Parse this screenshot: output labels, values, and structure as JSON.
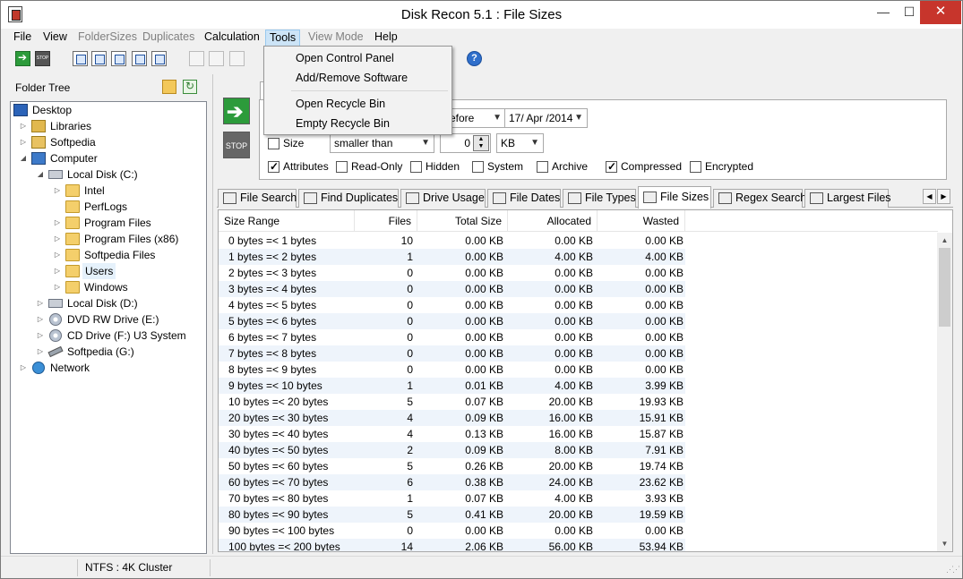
{
  "window": {
    "title": "Disk Recon 5.1 : File Sizes",
    "controls": {
      "minimize": "—",
      "maximize": "☐",
      "close": "✕"
    }
  },
  "menubar": {
    "items": [
      {
        "label": "File",
        "state": "normal"
      },
      {
        "label": "View",
        "state": "normal"
      },
      {
        "label": "FolderSizes",
        "state": "disabled"
      },
      {
        "label": "Duplicates",
        "state": "disabled"
      },
      {
        "label": "Calculation",
        "state": "normal"
      },
      {
        "label": "Tools",
        "state": "open"
      },
      {
        "label": "View Mode",
        "state": "disabled"
      },
      {
        "label": "Help",
        "state": "normal"
      }
    ]
  },
  "tools_menu": {
    "items": [
      "Open Control Panel",
      "Add/Remove Software",
      "Open Recycle Bin",
      "Empty Recycle Bin"
    ]
  },
  "toolbar": {
    "icons": [
      "start-scan-icon",
      "stop-scan-icon",
      "export-excel-icon",
      "export-html-icon",
      "export-csv-icon",
      "export-txt-icon",
      "export-xml-icon",
      "move-icon",
      "rename-icon",
      "delete-icon",
      "help-icon"
    ],
    "help_glyph": "?",
    "go_glyph": "➔",
    "stop_text": "STOP"
  },
  "folder_tree": {
    "label": "Folder Tree",
    "nodes": [
      {
        "label": "Desktop",
        "icon": "desktop",
        "arrow": ""
      },
      {
        "label": "Libraries",
        "icon": "libs",
        "arrow": "▷"
      },
      {
        "label": "Softpedia",
        "icon": "soft",
        "arrow": "▷"
      },
      {
        "label": "Computer",
        "icon": "computer",
        "arrow": "◢"
      },
      {
        "label": "Local Disk (C:)",
        "icon": "drive",
        "arrow": "◢"
      },
      {
        "label": "Intel",
        "icon": "folder",
        "arrow": "▷"
      },
      {
        "label": "PerfLogs",
        "icon": "folder",
        "arrow": ""
      },
      {
        "label": "Program Files",
        "icon": "folder",
        "arrow": "▷"
      },
      {
        "label": "Program Files (x86)",
        "icon": "folder",
        "arrow": "▷"
      },
      {
        "label": "Softpedia Files",
        "icon": "folder",
        "arrow": "▷"
      },
      {
        "label": "Users",
        "icon": "folder",
        "arrow": "▷"
      },
      {
        "label": "Windows",
        "icon": "folder",
        "arrow": "▷"
      },
      {
        "label": "Local Disk (D:)",
        "icon": "drive",
        "arrow": "▷"
      },
      {
        "label": "DVD RW Drive (E:)",
        "icon": "disc",
        "arrow": "▷"
      },
      {
        "label": "CD Drive (F:) U3 System",
        "icon": "disc",
        "arrow": "▷"
      },
      {
        "label": "Softpedia (G:)",
        "icon": "pen",
        "arrow": "▷"
      },
      {
        "label": "Network",
        "icon": "net",
        "arrow": "▷"
      }
    ]
  },
  "filters": {
    "date_mode": "efore",
    "date_value": "17/ Apr /2014",
    "size_label": "Size",
    "size_checked": false,
    "size_op": "smaller than",
    "size_value": "0",
    "size_unit": "KB",
    "attributes": [
      {
        "label": "Attributes",
        "checked": true
      },
      {
        "label": "Read-Only",
        "checked": false
      },
      {
        "label": "Hidden",
        "checked": false
      },
      {
        "label": "System",
        "checked": false
      },
      {
        "label": "Archive",
        "checked": false
      },
      {
        "label": "Compressed",
        "checked": true
      },
      {
        "label": "Encrypted",
        "checked": false
      }
    ]
  },
  "tabs": {
    "items": [
      "File Search",
      "Find Duplicates",
      "Drive Usage",
      "File Dates",
      "File Types",
      "File Sizes",
      "Regex Search",
      "Largest Files"
    ],
    "active": "File Sizes",
    "scroll_left": "◀",
    "scroll_right": "▶"
  },
  "table": {
    "columns": [
      "Size Range",
      "Files",
      "Total Size",
      "Allocated",
      "Wasted"
    ],
    "rows": [
      [
        "0 bytes =< 1 bytes",
        "10",
        "0.00 KB",
        "0.00 KB",
        "0.00 KB"
      ],
      [
        "1 bytes =< 2 bytes",
        "1",
        "0.00 KB",
        "4.00 KB",
        "4.00 KB"
      ],
      [
        "2 bytes =< 3 bytes",
        "0",
        "0.00 KB",
        "0.00 KB",
        "0.00 KB"
      ],
      [
        "3 bytes =< 4 bytes",
        "0",
        "0.00 KB",
        "0.00 KB",
        "0.00 KB"
      ],
      [
        "4 bytes =< 5 bytes",
        "0",
        "0.00 KB",
        "0.00 KB",
        "0.00 KB"
      ],
      [
        "5 bytes =< 6 bytes",
        "0",
        "0.00 KB",
        "0.00 KB",
        "0.00 KB"
      ],
      [
        "6 bytes =< 7 bytes",
        "0",
        "0.00 KB",
        "0.00 KB",
        "0.00 KB"
      ],
      [
        "7 bytes =< 8 bytes",
        "0",
        "0.00 KB",
        "0.00 KB",
        "0.00 KB"
      ],
      [
        "8 bytes =< 9 bytes",
        "0",
        "0.00 KB",
        "0.00 KB",
        "0.00 KB"
      ],
      [
        "9 bytes =< 10 bytes",
        "1",
        "0.01 KB",
        "4.00 KB",
        "3.99 KB"
      ],
      [
        "10 bytes =< 20 bytes",
        "5",
        "0.07 KB",
        "20.00 KB",
        "19.93 KB"
      ],
      [
        "20 bytes =< 30 bytes",
        "4",
        "0.09 KB",
        "16.00 KB",
        "15.91 KB"
      ],
      [
        "30 bytes =< 40 bytes",
        "4",
        "0.13 KB",
        "16.00 KB",
        "15.87 KB"
      ],
      [
        "40 bytes =< 50 bytes",
        "2",
        "0.09 KB",
        "8.00 KB",
        "7.91 KB"
      ],
      [
        "50 bytes =< 60 bytes",
        "5",
        "0.26 KB",
        "20.00 KB",
        "19.74 KB"
      ],
      [
        "60 bytes =< 70 bytes",
        "6",
        "0.38 KB",
        "24.00 KB",
        "23.62 KB"
      ],
      [
        "70 bytes =< 80 bytes",
        "1",
        "0.07 KB",
        "4.00 KB",
        "3.93 KB"
      ],
      [
        "80 bytes =< 90 bytes",
        "5",
        "0.41 KB",
        "20.00 KB",
        "19.59 KB"
      ],
      [
        "90 bytes =< 100 bytes",
        "0",
        "0.00 KB",
        "0.00 KB",
        "0.00 KB"
      ],
      [
        "100 bytes =< 200 bytes",
        "14",
        "2.06 KB",
        "56.00 KB",
        "53.94 KB"
      ]
    ]
  },
  "statusbar": {
    "fs_info": "NTFS : 4K Cluster"
  }
}
